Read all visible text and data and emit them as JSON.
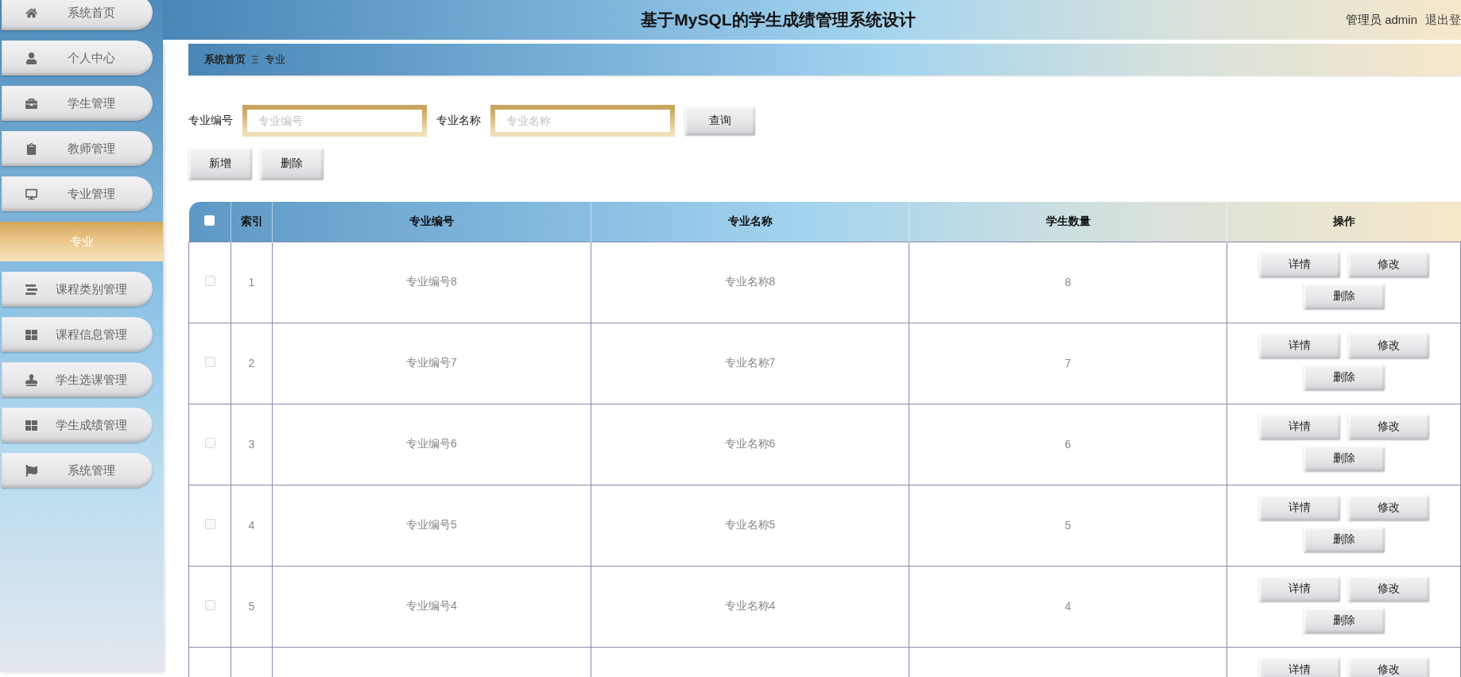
{
  "header": {
    "title": "基于MySQL的学生成绩管理系统设计",
    "user": "管理员 admin",
    "logout": "退出登"
  },
  "sidebar": {
    "items": [
      {
        "label": "系统首页"
      },
      {
        "label": "个人中心"
      },
      {
        "label": "学生管理"
      },
      {
        "label": "教师管理"
      },
      {
        "label": "专业管理",
        "children": [
          {
            "label": "专业",
            "selected": true
          }
        ]
      },
      {
        "label": "课程类别管理"
      },
      {
        "label": "课程信息管理"
      },
      {
        "label": "学生选课管理"
      },
      {
        "label": "学生成绩管理"
      },
      {
        "label": "系统管理"
      }
    ]
  },
  "breadcrumb": {
    "home": "系统首页",
    "current": "专业"
  },
  "filters": [
    {
      "label": "专业编号",
      "placeholder": "专业编号"
    },
    {
      "label": "专业名称",
      "placeholder": "专业名称"
    }
  ],
  "search_button": "查询",
  "action_buttons": [
    "新增",
    "删除"
  ],
  "table": {
    "header_checked": false,
    "columns": [
      "索引",
      "专业编号",
      "专业名称",
      "学生数量",
      "操作"
    ],
    "rows": [
      {
        "checked": false,
        "cells": [
          "1",
          "专业编号8",
          "专业名称8",
          "8"
        ],
        "actions": [
          "详情",
          "修改",
          "删除"
        ]
      },
      {
        "checked": false,
        "cells": [
          "2",
          "专业编号7",
          "专业名称7",
          "7"
        ],
        "actions": [
          "详情",
          "修改",
          "删除"
        ]
      },
      {
        "checked": false,
        "cells": [
          "3",
          "专业编号6",
          "专业名称6",
          "6"
        ],
        "actions": [
          "详情",
          "修改",
          "删除"
        ]
      },
      {
        "checked": false,
        "cells": [
          "4",
          "专业编号5",
          "专业名称5",
          "5"
        ],
        "actions": [
          "详情",
          "修改",
          "删除"
        ]
      },
      {
        "checked": false,
        "cells": [
          "5",
          "专业编号4",
          "专业名称4",
          "4"
        ],
        "actions": [
          "详情",
          "修改",
          "删除"
        ]
      },
      {
        "cells": [],
        "actions": [
          "详情",
          "修改"
        ]
      }
    ]
  }
}
